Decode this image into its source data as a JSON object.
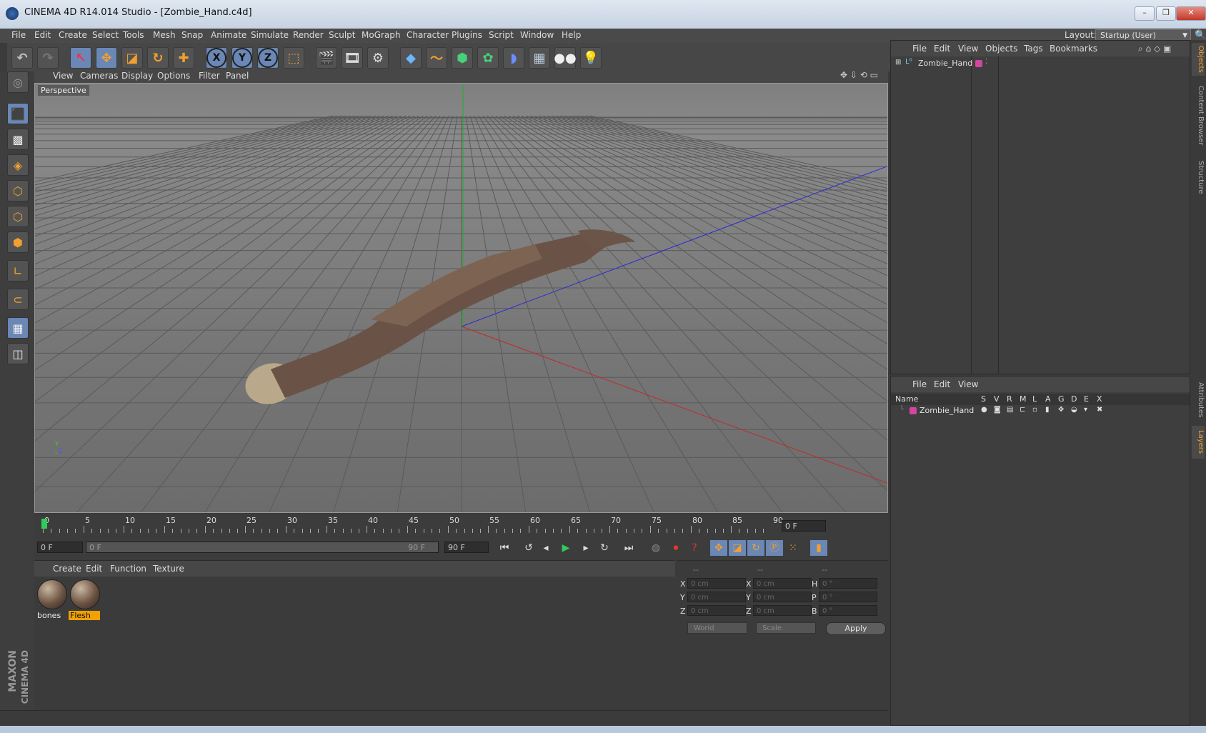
{
  "window": {
    "title": "CINEMA 4D R14.014 Studio - [Zombie_Hand.c4d]",
    "controls": [
      "–",
      "❐",
      "✕"
    ]
  },
  "menu": {
    "items": [
      "File",
      "Edit",
      "Create",
      "Select",
      "Tools",
      "Mesh",
      "Snap",
      "Animate",
      "Simulate",
      "Render",
      "Sculpt",
      "MoGraph",
      "Character",
      "Plugins",
      "Script",
      "Window",
      "Help"
    ],
    "layout_label": "Layout:",
    "layout_value": "Startup (User)"
  },
  "viewport": {
    "menu": [
      "View",
      "Cameras",
      "Display",
      "Options",
      "Filter",
      "Panel"
    ],
    "label": "Perspective"
  },
  "timeline": {
    "ticks": [
      "0",
      "5",
      "10",
      "15",
      "20",
      "25",
      "30",
      "35",
      "40",
      "45",
      "50",
      "55",
      "60",
      "65",
      "70",
      "75",
      "80",
      "85",
      "90"
    ],
    "current_frame": "0 F",
    "start_frame": "0 F",
    "range_start": "0 F",
    "range_end": "90 F",
    "end_frame": "90 F"
  },
  "materials": {
    "menu": [
      "Create",
      "Edit",
      "Function",
      "Texture"
    ],
    "items": [
      {
        "name": "bones",
        "selected": false
      },
      {
        "name": "Flesh",
        "selected": true
      }
    ]
  },
  "coordinates": {
    "headers": [
      "--",
      "--",
      "--"
    ],
    "rows": [
      {
        "l1": "X",
        "v1": "0 cm",
        "l2": "X",
        "v2": "0 cm",
        "l3": "H",
        "v3": "0 °"
      },
      {
        "l1": "Y",
        "v1": "0 cm",
        "l2": "Y",
        "v2": "0 cm",
        "l3": "P",
        "v3": "0 °"
      },
      {
        "l1": "Z",
        "v1": "0 cm",
        "l2": "Z",
        "v2": "0 cm",
        "l3": "B",
        "v3": "0 °"
      }
    ],
    "space": "World",
    "mode": "Scale",
    "apply": "Apply"
  },
  "object_manager": {
    "menu": [
      "File",
      "Edit",
      "View",
      "Objects",
      "Tags",
      "Bookmarks"
    ],
    "objects": [
      {
        "name": "Zombie_Hand",
        "color": "#d046a0"
      }
    ]
  },
  "layer_manager": {
    "menu": [
      "File",
      "Edit",
      "View"
    ],
    "columns": [
      "Name",
      "S",
      "V",
      "R",
      "M",
      "L",
      "A",
      "G",
      "D",
      "E",
      "X"
    ],
    "layers": [
      {
        "name": "Zombie_Hand",
        "color": "#d046a0"
      }
    ]
  },
  "side_tabs": [
    "Objects",
    "Content Browser",
    "Structure",
    "Attributes",
    "Layers"
  ],
  "branding": {
    "line1": "MAXON",
    "line2": "CINEMA 4D"
  },
  "colors": {
    "accent": "#f0a030",
    "selection": "#6a87b5",
    "layer": "#d046a0"
  }
}
